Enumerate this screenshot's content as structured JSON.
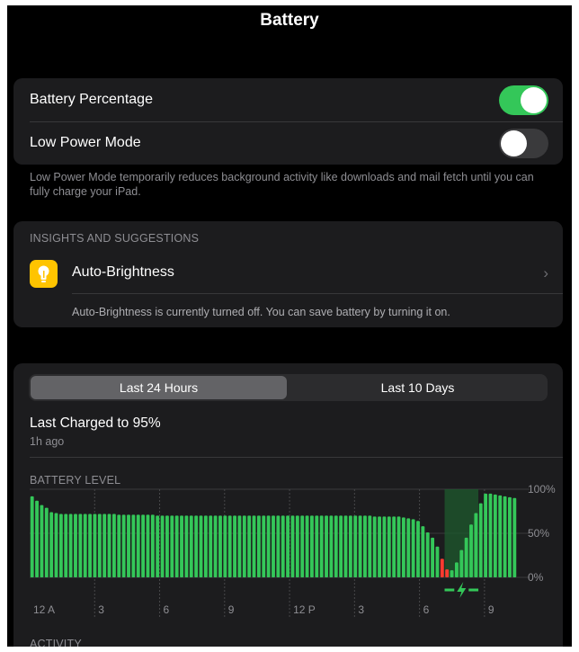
{
  "header": {
    "title": "Battery"
  },
  "settings": {
    "battery_percentage": {
      "label": "Battery Percentage",
      "on": true
    },
    "low_power_mode": {
      "label": "Low Power Mode",
      "on": false
    },
    "footnote": "Low Power Mode temporarily reduces background activity like downloads and mail fetch until you can fully charge your iPad."
  },
  "insights": {
    "header": "INSIGHTS AND SUGGESTIONS",
    "item": {
      "label": "Auto-Brightness",
      "icon": "lightbulb-icon",
      "icon_color": "#ffc400"
    },
    "description": "Auto-Brightness is currently turned off. You can save battery by turning it on."
  },
  "usage": {
    "tabs": [
      {
        "label": "Last 24 Hours",
        "selected": true
      },
      {
        "label": "Last 10 Days",
        "selected": false
      }
    ],
    "last_charged": "Last Charged to 95%",
    "last_charged_time": "1h ago",
    "battery_level_header": "BATTERY LEVEL",
    "activity_header": "ACTIVITY"
  },
  "chart_data": {
    "type": "bar",
    "title": "BATTERY LEVEL",
    "y_tick_labels": [
      "100%",
      "50%",
      "0%"
    ],
    "ylim": [
      0,
      100
    ],
    "x_tick_labels": [
      "12 A",
      "3",
      "6",
      "9",
      "12 P",
      "3",
      "6",
      "9"
    ],
    "grid": true,
    "colors": {
      "normal": "#34c759",
      "low": "#ff3b30",
      "charging_band": "#1e5a2e"
    },
    "charging_icon": "charging-bolt-icon",
    "charging_range": [
      86,
      93
    ],
    "values": [
      92,
      87,
      82,
      79,
      74,
      73,
      72,
      72,
      72,
      72,
      72,
      72,
      72,
      72,
      72,
      72,
      72,
      72,
      71,
      71,
      71,
      71,
      71,
      71,
      71,
      71,
      70,
      70,
      70,
      70,
      70,
      70,
      70,
      70,
      70,
      70,
      70,
      70,
      70,
      70,
      70,
      70,
      70,
      70,
      70,
      70,
      70,
      70,
      70,
      70,
      70,
      70,
      70,
      70,
      70,
      70,
      70,
      70,
      70,
      70,
      70,
      70,
      70,
      70,
      70,
      70,
      70,
      70,
      70,
      70,
      70,
      69,
      69,
      69,
      69,
      69,
      69,
      68,
      67,
      66,
      64,
      58,
      51,
      45,
      35,
      21,
      9,
      8,
      17,
      31,
      45,
      60,
      73,
      84,
      95,
      95,
      94,
      93,
      92,
      91,
      90
    ],
    "low_indices": [
      85,
      86
    ]
  }
}
